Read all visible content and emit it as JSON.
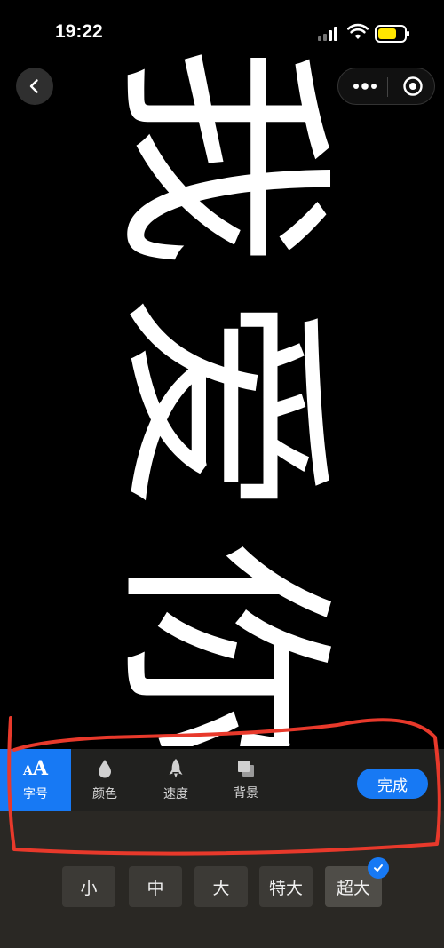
{
  "status_bar": {
    "time": "19:22"
  },
  "nav": {
    "back_icon": "chevron-left-icon",
    "more_icon": "more-dots-icon",
    "close_icon": "target-circle-icon"
  },
  "marquee": {
    "characters": [
      "我",
      "爱",
      "你"
    ],
    "orientation": "rotated-90-degrees",
    "text_color": "#ffffff",
    "background_color": "#000000"
  },
  "toolbar": {
    "tools": [
      {
        "label": "字号",
        "icon": "font-size-icon",
        "active": true
      },
      {
        "label": "颜色",
        "icon": "droplet-icon",
        "active": false
      },
      {
        "label": "速度",
        "icon": "rocket-icon",
        "active": false
      },
      {
        "label": "背景",
        "icon": "layers-icon",
        "active": false
      }
    ],
    "done_label": "完成",
    "accent_color": "#1779f4"
  },
  "size_options": {
    "items": [
      "小",
      "中",
      "大",
      "特大",
      "超大"
    ],
    "selected": "超大"
  },
  "annotation": {
    "color": "#e8392b",
    "shape": "hand-drawn-outline"
  }
}
